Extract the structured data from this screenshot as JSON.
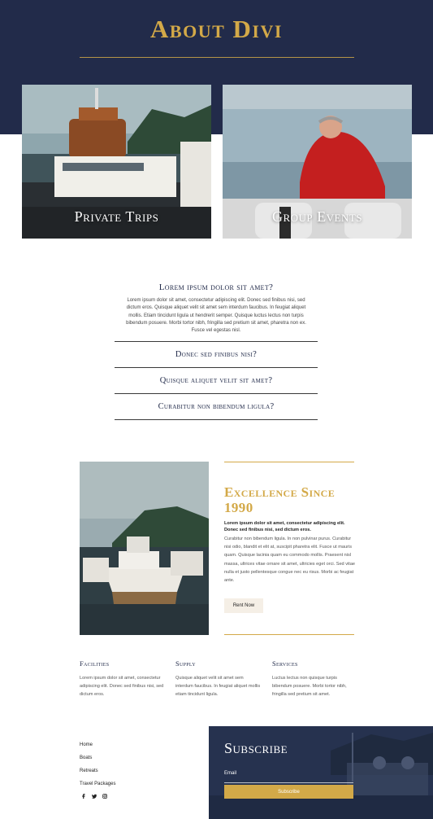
{
  "hero": {
    "title": "About Divi"
  },
  "cards": [
    {
      "title": "Private Trips"
    },
    {
      "title": "Group Events"
    }
  ],
  "faq": {
    "open_question": "Lorem ipsum dolor sit amet?",
    "open_answer": "Lorem ipsum dolor sit amet, consectetur adipiscing elit. Donec sed finibus nisi, sed dictum eros. Quisque aliquet velit sit amet sem interdum faucibus. In feugiat aliquet mollis. Etiam tincidunt ligula ut hendrerit semper. Quisque luctus lectus non turpis bibendum posuere. Morbi tortor nibh, fringilla sed pretium sit amet, pharetra non ex. Fusce vel egestas nisl.",
    "items": [
      "Donec sed finibus nisi?",
      "Quisque aliquet velit sit amet?",
      "Curabitur non bibendum ligula?"
    ]
  },
  "excellence": {
    "title": "Excellence Since 1990",
    "lead": "Lorem ipsum dolor sit amet, consectetur adipiscing elit. Donec sed finibus nisi, sed dictum eros.",
    "body": "Curabitur non bibendum ligula. In non pulvinar purus. Curabitur nisi odio, blandit et elit at, suscipit pharetra elit. Fusce ut mauris quam. Quisque lacinia quam eu commodo mollis. Praesent nisl massa, ultrices vitae ornare sit amet, ultricies eget orci. Sed vitae nulla et justo pellentesque congue nec eu risus. Morbi ac feugiat ante.",
    "button": "Rent Now"
  },
  "columns": [
    {
      "heading": "Facilities",
      "text": "Lorem ipsum dolor sit amet, consectetur adipiscing elit. Donec sed finibus nisi, sed dictum eros."
    },
    {
      "heading": "Supply",
      "text": "Quisque aliquet velit sit amet sem interdum faucibus. In feugiat aliquet mollis etiam tincidunt ligula."
    },
    {
      "heading": "Services",
      "text": "Luctus lectus non quisque turpis bibendum posuere. Morbi tortor nibh, fringilla sed pretium sit amet."
    }
  ],
  "footer": {
    "links": [
      "Home",
      "Boats",
      "Retreats",
      "Travel Packages"
    ],
    "socials": [
      "facebook-icon",
      "twitter-icon",
      "instagram-icon"
    ]
  },
  "subscribe": {
    "title": "Subscribe",
    "email_label": "Email",
    "email_value": "",
    "button": "Subscribe"
  },
  "colors": {
    "navy": "#222b4a",
    "gold": "#d3a948",
    "cream": "#f5efe6"
  }
}
